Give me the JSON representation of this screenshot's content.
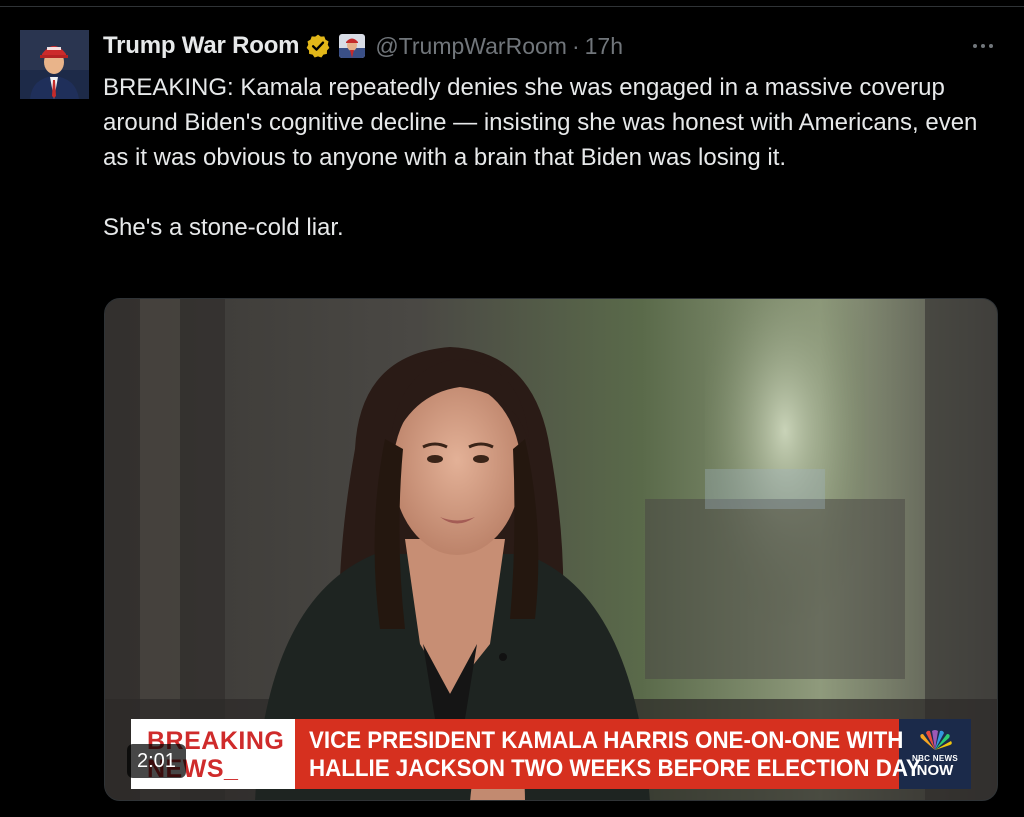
{
  "author": {
    "display_name": "Trump War Room",
    "handle": "@TrumpWarRoom",
    "separator": "·",
    "time_ago": "17h",
    "verified_color": "#e2b719"
  },
  "tweet": {
    "paragraphs": [
      "BREAKING: Kamala repeatedly denies she was engaged in a massive coverup around Biden's cognitive decline — insisting she was honest with Americans, even as it was obvious to anyone with a brain that Biden was losing it.",
      "She's a stone-cold liar."
    ]
  },
  "video": {
    "duration": "2:01",
    "chyron_tag_line1": "BREAKING",
    "chyron_tag_line2": "NEWS_",
    "chyron_line1": "VICE PRESIDENT KAMALA HARRIS ONE-ON-ONE WITH",
    "chyron_line2": "HALLIE JACKSON TWO WEEKS BEFORE ELECTION DAY",
    "network_label": "NBC NEWS",
    "network_sub": "NOW",
    "chyron_color": "#d6301f"
  },
  "icons": {
    "verified": "verified-badge-icon",
    "more": "more-horizontal-icon",
    "affiliate": "affiliate-badge-icon"
  }
}
